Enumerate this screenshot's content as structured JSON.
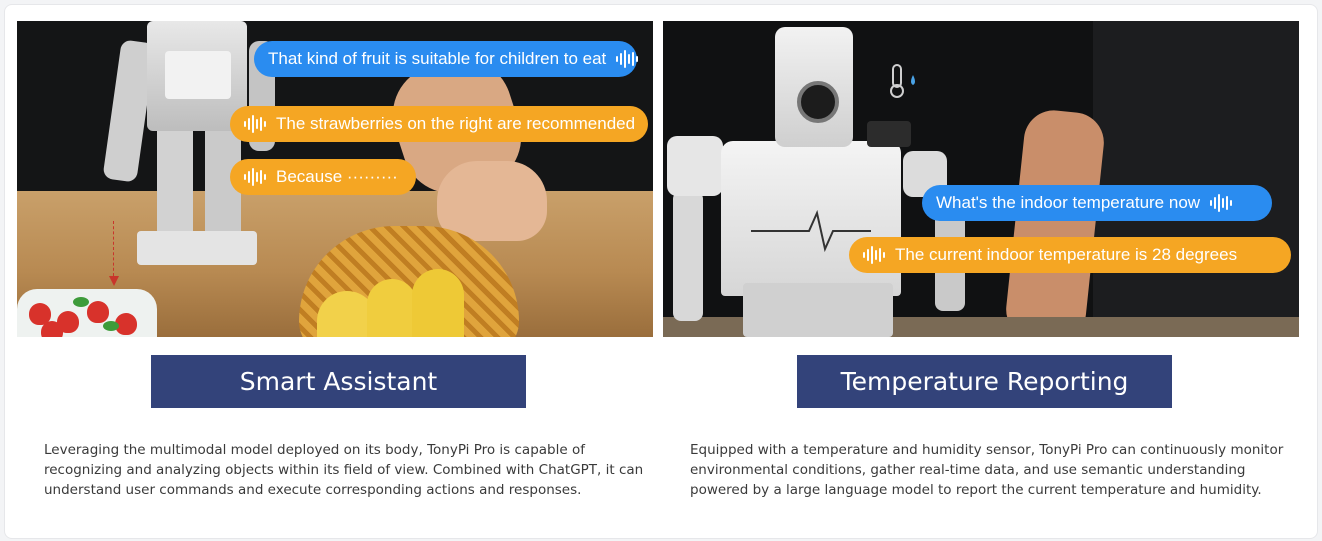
{
  "left": {
    "bubbles": [
      {
        "text": "That kind of fruit is suitable for children to eat",
        "color": "blue",
        "icon": "voice-wave-icon",
        "icon_position": "end"
      },
      {
        "text": "The strawberries on the right are recommended",
        "color": "orange",
        "icon": "voice-wave-icon",
        "icon_position": "start"
      },
      {
        "text": "Because ·········",
        "color": "orange",
        "icon": "voice-wave-icon",
        "icon_position": "start"
      }
    ],
    "title": "Smart Assistant",
    "description": "Leveraging the multimodal model deployed on its body, TonyPi Pro is capable of recognizing and analyzing objects within its field of view. Combined with ChatGPT, it can understand user commands and execute corresponding actions and responses."
  },
  "right": {
    "bubbles": [
      {
        "text": "What's the indoor temperature now",
        "color": "blue",
        "icon": "voice-wave-icon",
        "icon_position": "end"
      },
      {
        "text": "The current indoor temperature is 28 degrees",
        "color": "orange",
        "icon": "voice-wave-icon",
        "icon_position": "start"
      }
    ],
    "title": "Temperature Reporting",
    "description": "Equipped with a temperature and humidity sensor, TonyPi Pro can continuously monitor environmental conditions, gather real-time data, and use semantic understanding powered by a large language model to report the current temperature and humidity."
  },
  "colors": {
    "bubble_blue": "#2a8cf0",
    "bubble_orange": "#f5a623",
    "title_bg": "#33437a",
    "title_text": "#ffffff",
    "body_text": "#3a3a3a"
  }
}
